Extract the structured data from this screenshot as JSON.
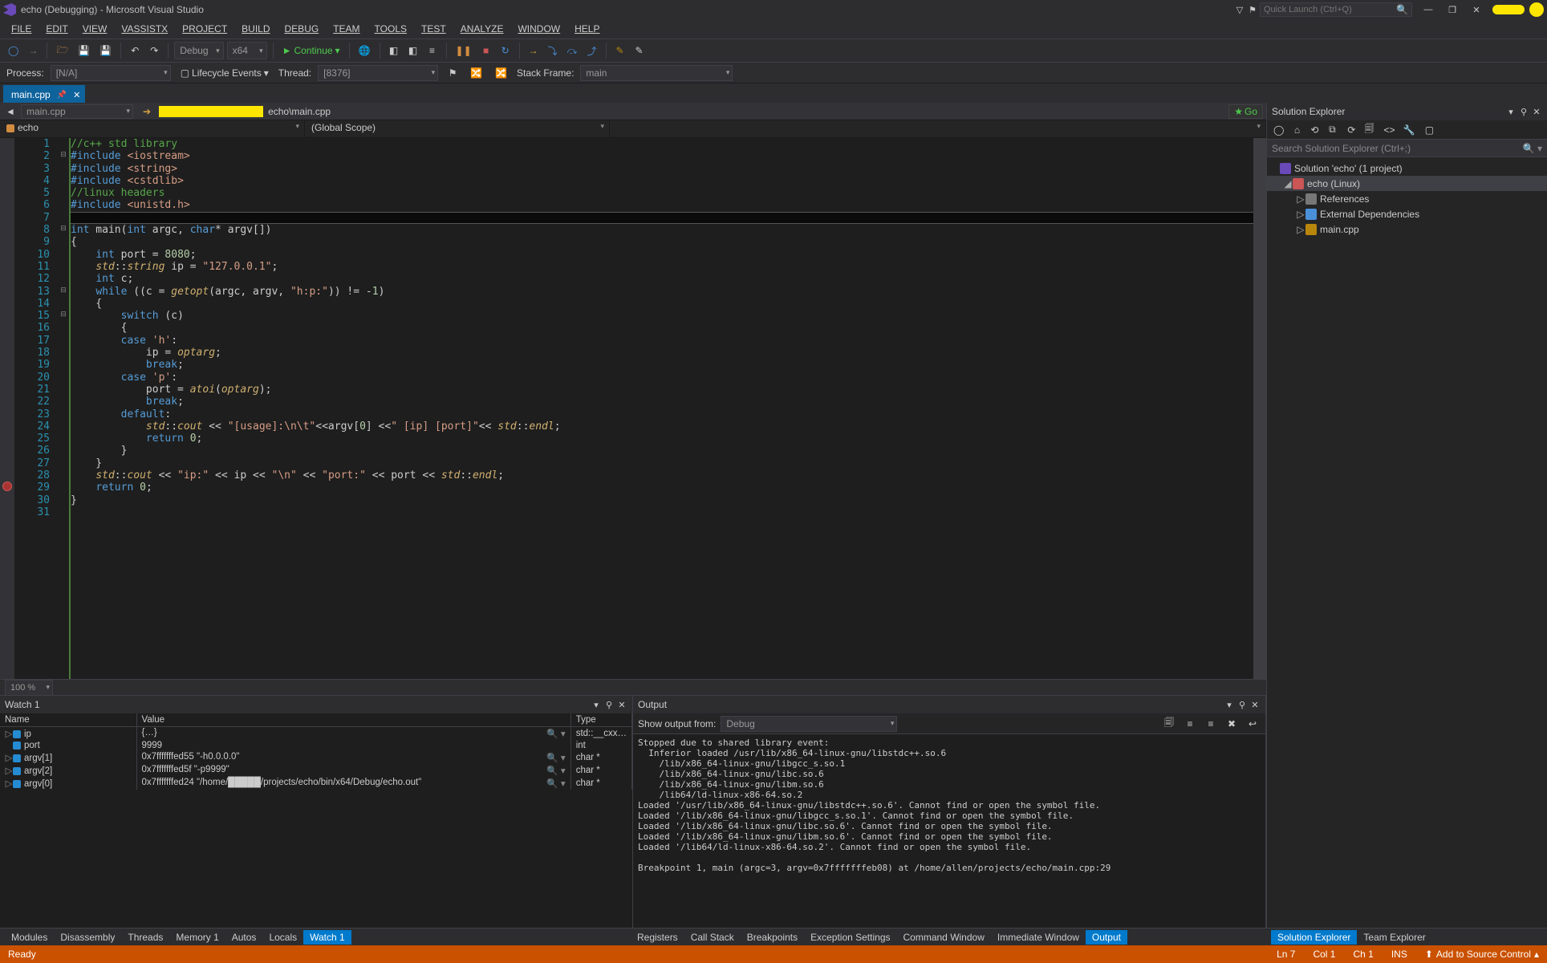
{
  "title": "echo (Debugging) - Microsoft Visual Studio",
  "quick_launch_placeholder": "Quick Launch (Ctrl+Q)",
  "menu": {
    "file": "FILE",
    "edit": "EDIT",
    "view": "VIEW",
    "vassistx": "VASSISTX",
    "project": "PROJECT",
    "build": "BUILD",
    "debug": "DEBUG",
    "team": "TEAM",
    "tools": "TOOLS",
    "test": "TEST",
    "analyze": "ANALYZE",
    "window": "WINDOW",
    "help": "HELP"
  },
  "toolbar": {
    "config": "Debug",
    "platform": "x64",
    "continue": "Continue"
  },
  "debugstrip": {
    "process_label": "Process:",
    "process": "[N/A]",
    "lifecycle": "Lifecycle Events",
    "thread_label": "Thread:",
    "thread": "[8376]",
    "stackframe_label": "Stack Frame:",
    "stackframe": "main"
  },
  "tab": {
    "name": "main.cpp"
  },
  "nav": {
    "file": "main.cpp",
    "path_suffix": "echo\\main.cpp",
    "go": "Go"
  },
  "scopes": {
    "project": "echo",
    "global": "(Global Scope)",
    "member": ""
  },
  "code": {
    "lines": [
      {
        "n": 1,
        "html": "<span class='cmt'>//c++ std library</span>"
      },
      {
        "n": 2,
        "html": "<span class='kw'>#include</span> <span class='str'>&lt;iostream&gt;</span>",
        "fold": "-"
      },
      {
        "n": 3,
        "html": "<span class='kw'>#include</span> <span class='str'>&lt;string&gt;</span>"
      },
      {
        "n": 4,
        "html": "<span class='kw'>#include</span> <span class='str'>&lt;cstdlib&gt;</span>"
      },
      {
        "n": 5,
        "html": "<span class='cmt'>//linux headers</span>"
      },
      {
        "n": 6,
        "html": "<span class='kw'>#include</span> <span class='str'>&lt;unistd.h&gt;</span>"
      },
      {
        "n": 7,
        "html": "",
        "hl": true
      },
      {
        "n": 8,
        "html": "<span class='kw'>int</span> main(<span class='kw'>int</span> argc, <span class='kw'>char</span>* argv[])",
        "fold": "-"
      },
      {
        "n": 9,
        "html": "{"
      },
      {
        "n": 10,
        "html": "    <span class='kw'>int</span> port = <span class='num'>8080</span>;"
      },
      {
        "n": 11,
        "html": "    <span class='it'>std</span>::<span class='it'>string</span> ip = <span class='str'>\"127.0.0.1\"</span>;"
      },
      {
        "n": 12,
        "html": "    <span class='kw'>int</span> c;"
      },
      {
        "n": 13,
        "html": "    <span class='kw'>while</span> ((c = <span class='it'>getopt</span>(argc, argv, <span class='str'>\"h:p:\"</span>)) != -<span class='num'>1</span>)",
        "fold": "-"
      },
      {
        "n": 14,
        "html": "    {"
      },
      {
        "n": 15,
        "html": "        <span class='kw'>switch</span> (c)",
        "fold": "-"
      },
      {
        "n": 16,
        "html": "        {"
      },
      {
        "n": 17,
        "html": "        <span class='kw'>case</span> <span class='str'>'h'</span>:"
      },
      {
        "n": 18,
        "html": "            ip = <span class='it'>optarg</span>;"
      },
      {
        "n": 19,
        "html": "            <span class='kw'>break</span>;"
      },
      {
        "n": 20,
        "html": "        <span class='kw'>case</span> <span class='str'>'p'</span>:"
      },
      {
        "n": 21,
        "html": "            port = <span class='it'>atoi</span>(<span class='it'>optarg</span>);"
      },
      {
        "n": 22,
        "html": "            <span class='kw'>break</span>;"
      },
      {
        "n": 23,
        "html": "        <span class='kw'>default</span>:"
      },
      {
        "n": 24,
        "html": "            <span class='it'>std</span>::<span class='it'>cout</span> &lt;&lt; <span class='str'>\"[usage]:\\n\\t\"</span>&lt;&lt;argv[<span class='num'>0</span>] &lt;&lt;<span class='str'>\" [ip] [port]\"</span>&lt;&lt; <span class='it'>std</span>::<span class='it'>endl</span>;"
      },
      {
        "n": 25,
        "html": "            <span class='kw'>return</span> <span class='num'>0</span>;"
      },
      {
        "n": 26,
        "html": "        }"
      },
      {
        "n": 27,
        "html": "    }"
      },
      {
        "n": 28,
        "html": "    <span class='it'>std</span>::<span class='it'>cout</span> &lt;&lt; <span class='str'>\"ip:\"</span> &lt;&lt; ip &lt;&lt; <span class='str'>\"\\n\"</span> &lt;&lt; <span class='str'>\"port:\"</span> &lt;&lt; port &lt;&lt; <span class='it'>std</span>::<span class='it'>endl</span>;"
      },
      {
        "n": 29,
        "html": "    <span class='kw'>return</span> <span class='num'>0</span>;",
        "bp": true
      },
      {
        "n": 30,
        "html": "}"
      },
      {
        "n": 31,
        "html": ""
      }
    ],
    "zoom": "100 %"
  },
  "watch": {
    "title": "Watch 1",
    "columns": {
      "name": "Name",
      "value": "Value",
      "type": "Type"
    },
    "rows": [
      {
        "exp": "▷",
        "name": "ip",
        "value": "{…}",
        "type": "std::__cxx…",
        "mag": true
      },
      {
        "exp": " ",
        "name": "port",
        "value": "9999",
        "type": "int"
      },
      {
        "exp": "▷",
        "name": "argv[1]",
        "value": "0x7fffffffed55 \"-h0.0.0.0\"",
        "type": "char *",
        "mag": true
      },
      {
        "exp": "▷",
        "name": "argv[2]",
        "value": "0x7fffffffed5f \"-p9999\"",
        "type": "char *",
        "mag": true
      },
      {
        "exp": "▷",
        "name": "argv[0]",
        "value": "0x7fffffffed24 \"/home/█████/projects/echo/bin/x64/Debug/echo.out\"",
        "type": "char *",
        "mag": true
      }
    ]
  },
  "output": {
    "title": "Output",
    "show_from_label": "Show output from:",
    "show_from": "Debug",
    "text": "Stopped due to shared library event:\n  Inferior loaded /usr/lib/x86_64-linux-gnu/libstdc++.so.6\n    /lib/x86_64-linux-gnu/libgcc_s.so.1\n    /lib/x86_64-linux-gnu/libc.so.6\n    /lib/x86_64-linux-gnu/libm.so.6\n    /lib64/ld-linux-x86-64.so.2\nLoaded '/usr/lib/x86_64-linux-gnu/libstdc++.so.6'. Cannot find or open the symbol file.\nLoaded '/lib/x86_64-linux-gnu/libgcc_s.so.1'. Cannot find or open the symbol file.\nLoaded '/lib/x86_64-linux-gnu/libc.so.6'. Cannot find or open the symbol file.\nLoaded '/lib/x86_64-linux-gnu/libm.so.6'. Cannot find or open the symbol file.\nLoaded '/lib64/ld-linux-x86-64.so.2'. Cannot find or open the symbol file.\n\nBreakpoint 1, main (argc=3, argv=0x7fffffffeb08) at /home/allen/projects/echo/main.cpp:29"
  },
  "solution_explorer": {
    "title": "Solution Explorer",
    "search_placeholder": "Search Solution Explorer (Ctrl+;)",
    "tree": [
      {
        "d": 0,
        "icon": "i-sln",
        "label": "Solution 'echo' (1 project)",
        "tw": ""
      },
      {
        "d": 1,
        "icon": "i-proj",
        "label": "echo (Linux)",
        "tw": "◢",
        "sel": true
      },
      {
        "d": 2,
        "icon": "i-ref",
        "label": "References",
        "tw": "▷"
      },
      {
        "d": 2,
        "icon": "i-ext",
        "label": "External Dependencies",
        "tw": "▷"
      },
      {
        "d": 2,
        "icon": "i-cpp",
        "label": "main.cpp",
        "tw": "▷"
      }
    ]
  },
  "bottom_tabs": {
    "left": [
      "Modules",
      "Disassembly",
      "Threads",
      "Memory 1",
      "Autos",
      "Locals",
      "Watch 1"
    ],
    "left_active": 6,
    "mid": [
      "Registers",
      "Call Stack",
      "Breakpoints",
      "Exception Settings",
      "Command Window",
      "Immediate Window",
      "Output"
    ],
    "mid_active": 6,
    "right": [
      "Solution Explorer",
      "Team Explorer"
    ],
    "right_active": 0
  },
  "status": {
    "ready": "Ready",
    "ln": "Ln 7",
    "col": "Col 1",
    "ch": "Ch 1",
    "ins": "INS",
    "src": "Add to Source Control"
  }
}
